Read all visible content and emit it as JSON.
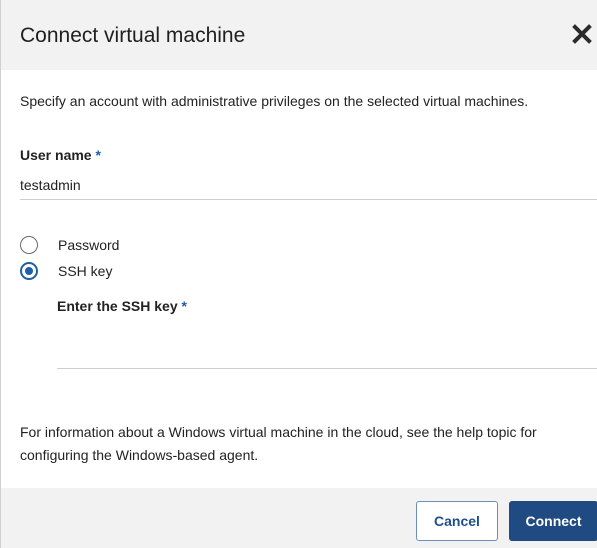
{
  "dialog": {
    "title": "Connect virtual machine",
    "close_icon": "close-icon"
  },
  "intro": "Specify an account with administrative privileges on the selected virtual machines.",
  "username": {
    "label": "User name",
    "required_marker": "*",
    "value": "testadmin"
  },
  "auth_options": [
    {
      "label": "Password",
      "selected": false
    },
    {
      "label": "SSH key",
      "selected": true
    }
  ],
  "ssh_key": {
    "label": "Enter the SSH key",
    "required_marker": "*",
    "value": ""
  },
  "info_text": "For information about a Windows virtual machine in the cloud, see the help topic for configuring the Windows-based agent.",
  "footer": {
    "cancel_label": "Cancel",
    "connect_label": "Connect"
  },
  "colors": {
    "accent": "#1f5fa8",
    "primary_button": "#1f4a82",
    "header_bg": "#f2f2f2"
  }
}
